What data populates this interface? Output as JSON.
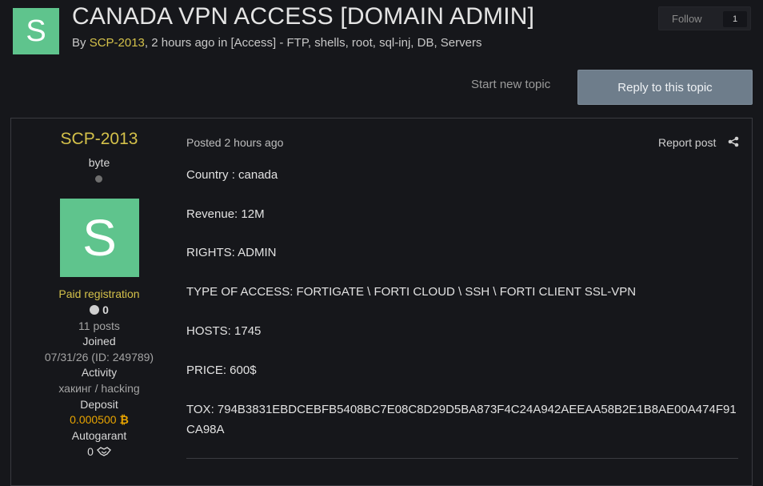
{
  "header": {
    "avatar_letter": "S",
    "title": "CANADA VPN ACCESS [DOMAIN ADMIN]",
    "byline_prefix": "By ",
    "author": "SCP-2013",
    "byline_middle": ", 2 hours ago in ",
    "forum": "[Access] - FTP, shells, root, sql-inj, DB, Servers",
    "follow_label": "Follow",
    "follow_count": "1"
  },
  "actions": {
    "start_new_topic": "Start new topic",
    "reply": "Reply to this topic"
  },
  "author_panel": {
    "name": "SCP-2013",
    "rank": "byte",
    "avatar_letter": "S",
    "group": "Paid registration",
    "reputation": "0",
    "posts": "11 posts",
    "joined_label": "Joined",
    "joined_value": "07/31/26 (ID: 249789)",
    "activity_label": "Activity",
    "activity_value": "хакинг / hacking",
    "deposit_label": "Deposit",
    "deposit_value": "0.000500",
    "autogarant_label": "Autogarant",
    "autogarant_value": "0"
  },
  "post": {
    "posted": "Posted 2 hours ago",
    "report": "Report post",
    "lines": [
      "Country : canada",
      "Revenue: 12M",
      "RIGHTS: ADMIN",
      "TYPE OF ACCESS: FORTIGATE \\ FORTI CLOUD \\ SSH \\ FORTI CLIENT SSL-VPN",
      "HOSTS: 1745",
      "PRICE: 600$",
      "TOX: 794B3831EBDCEBFB5408BC7E08C8D29D5BA873F4C24A942AEEAA58B2E1B8AE00A474F91CA98A"
    ]
  },
  "colors": {
    "background": "#16171b",
    "accent_gold": "#d4c14a",
    "avatar_green": "#5fc48d",
    "reply_button": "#6e7d8b",
    "bitcoin_orange": "#e8a400"
  },
  "icons": [
    "share-icon",
    "bitcoin-icon",
    "handshake-icon",
    "reputation-icon",
    "online-status-icon"
  ]
}
